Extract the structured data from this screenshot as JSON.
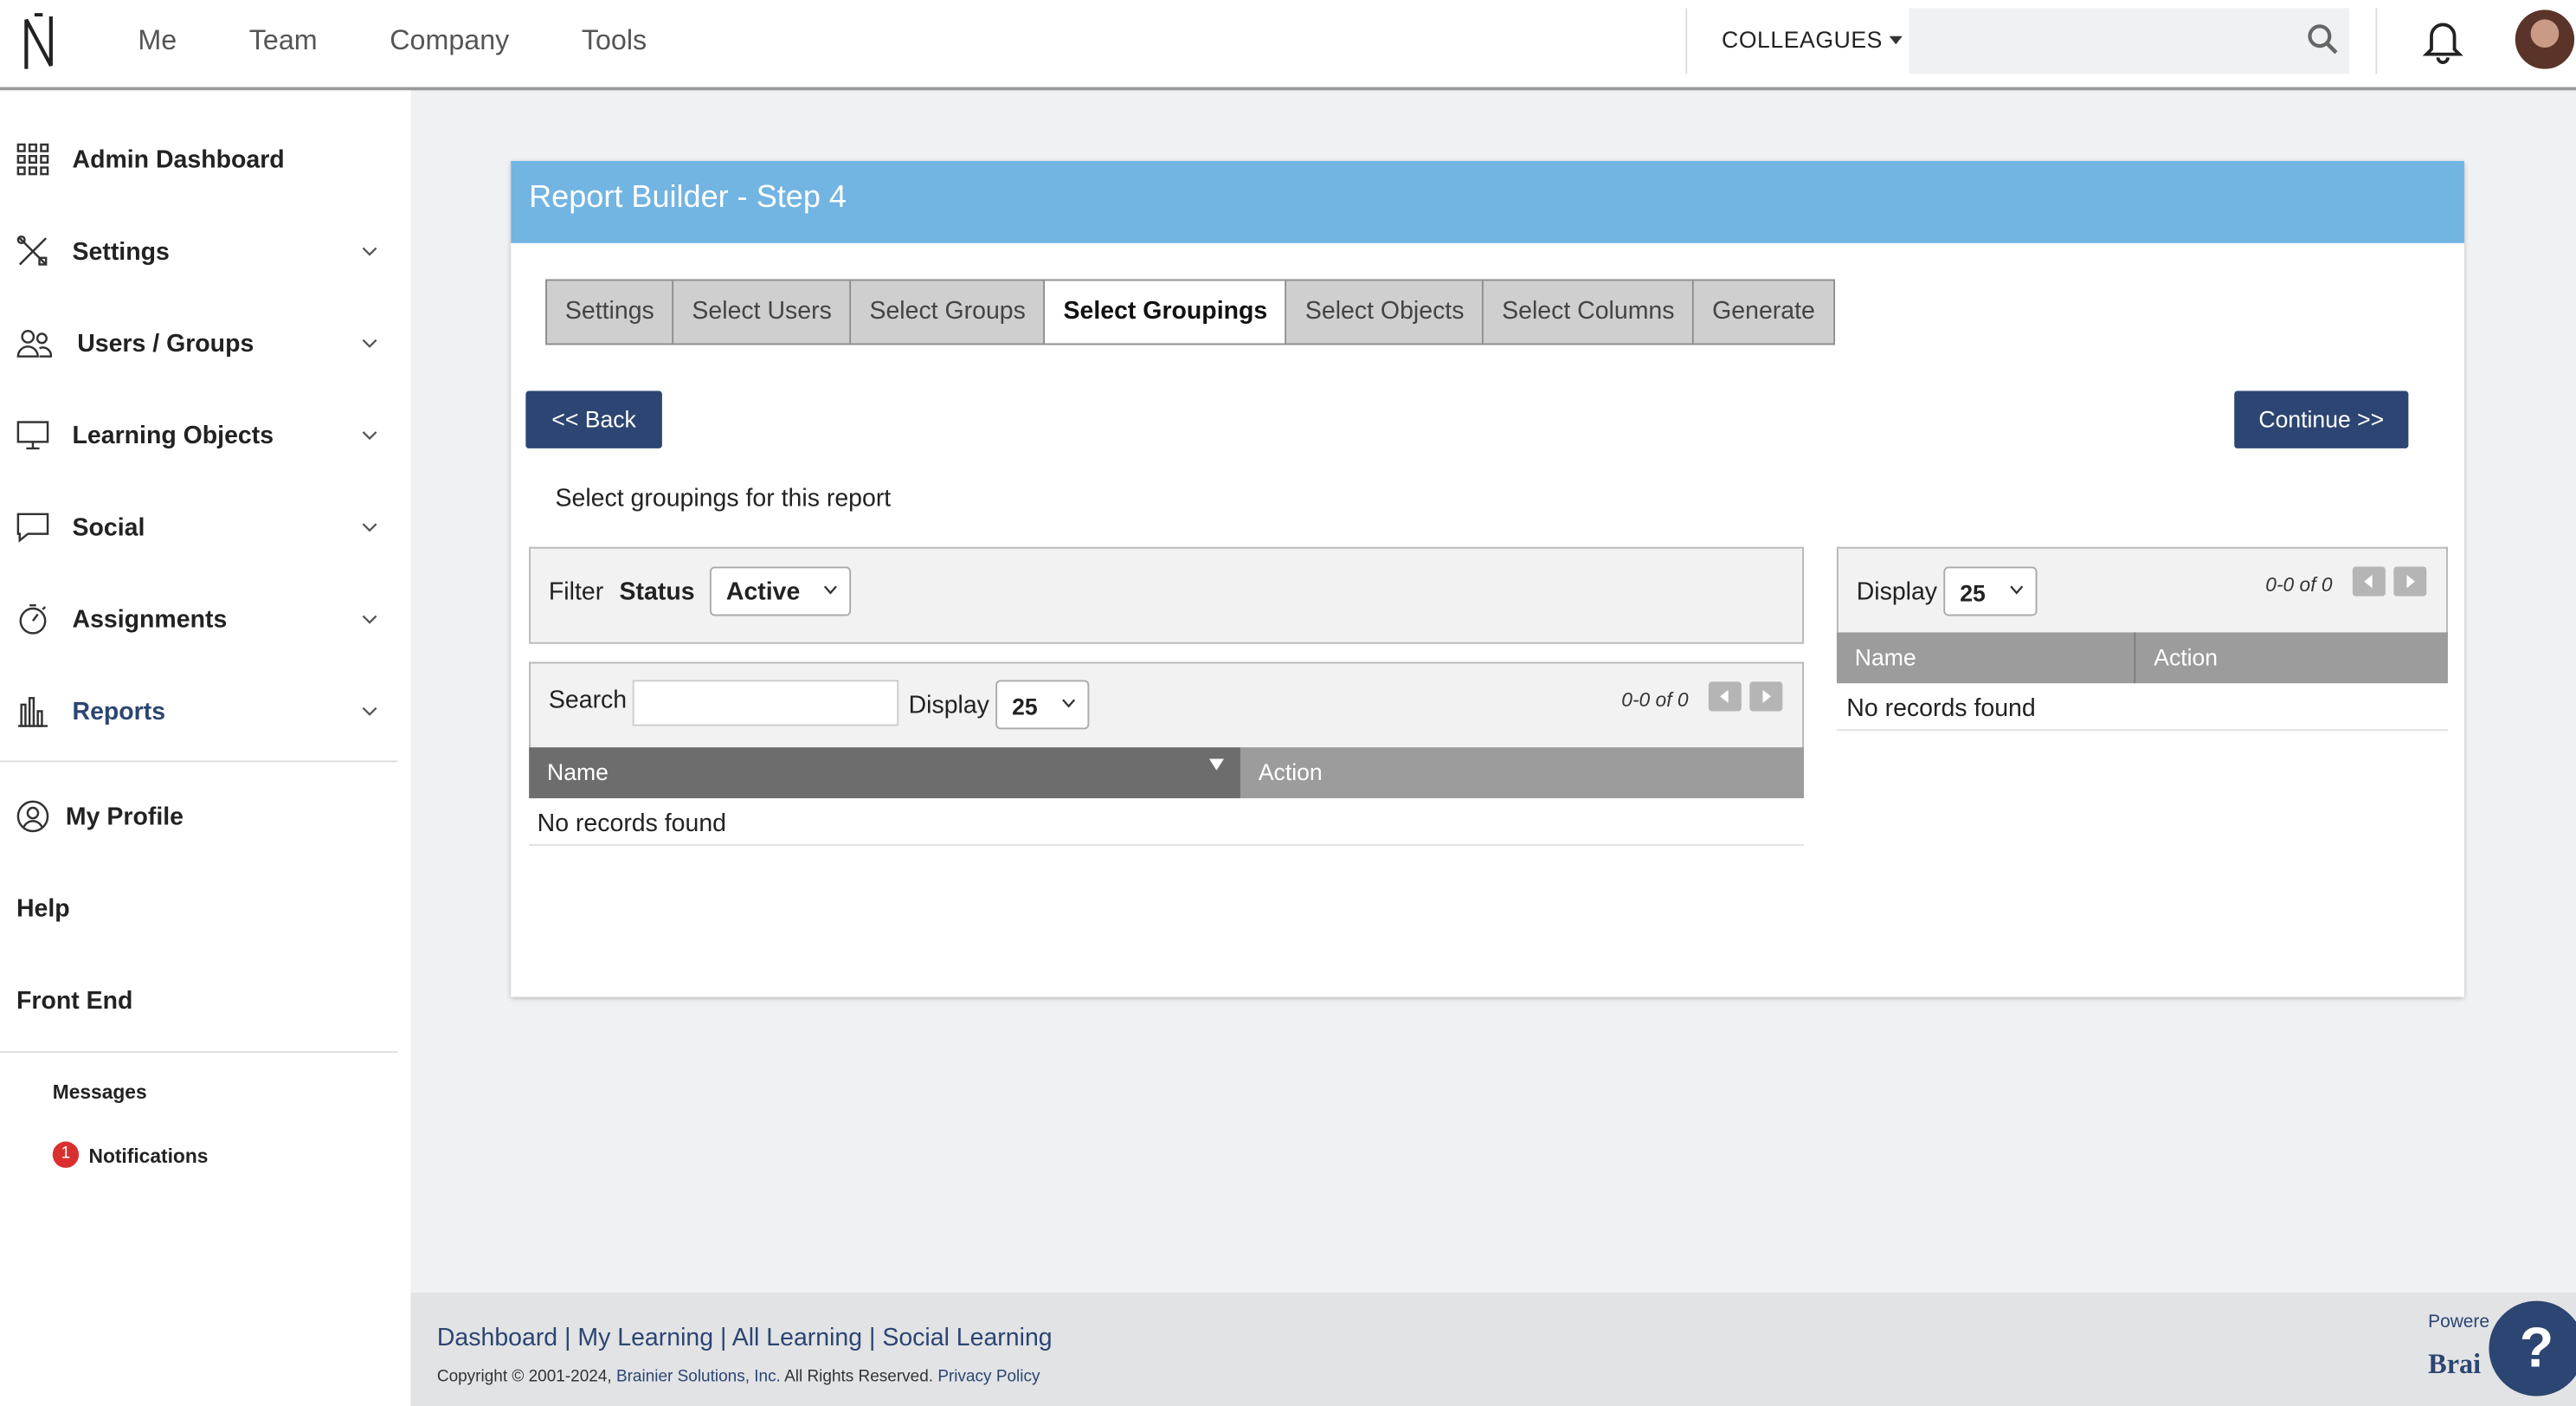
{
  "topbar": {
    "nav": [
      "Me",
      "Team",
      "Company",
      "Tools"
    ],
    "colleagues_label": "COLLEAGUES",
    "search_placeholder": ""
  },
  "sidebar": {
    "items": [
      {
        "label": "Admin Dashboard",
        "icon": "grid-icon",
        "has_chevron": false
      },
      {
        "label": "Settings",
        "icon": "tools-icon",
        "has_chevron": true
      },
      {
        "label": "Users / Groups",
        "icon": "users-icon",
        "has_chevron": true
      },
      {
        "label": "Learning Objects",
        "icon": "monitor-icon",
        "has_chevron": true
      },
      {
        "label": "Social",
        "icon": "chat-icon",
        "has_chevron": true
      },
      {
        "label": "Assignments",
        "icon": "stopwatch-icon",
        "has_chevron": true
      },
      {
        "label": "Reports",
        "icon": "bar-chart-icon",
        "has_chevron": true,
        "active": true
      }
    ],
    "my_profile": "My Profile",
    "help": "Help",
    "front_end": "Front End",
    "messages": "Messages",
    "notifications": "Notifications",
    "notifications_count": "1"
  },
  "card": {
    "title": "Report Builder - Step 4",
    "steps": [
      "Settings",
      "Select Users",
      "Select Groups",
      "Select Groupings",
      "Select Objects",
      "Select Columns",
      "Generate"
    ],
    "active_step": "Select Groupings",
    "back_label": "<< Back",
    "continue_label": "Continue >>",
    "instruction": "Select groupings for this report",
    "filter": {
      "label": "Filter",
      "status_label": "Status",
      "status_value": "Active"
    },
    "left_grid": {
      "search_label": "Search",
      "search_value": "",
      "display_label": "Display",
      "display_value": "25",
      "page_info": "0-0 of 0",
      "columns": [
        "Name",
        "Action"
      ],
      "empty_text": "No records found"
    },
    "right_grid": {
      "display_label": "Display",
      "display_value": "25",
      "page_info": "0-0 of 0",
      "columns": [
        "Name",
        "Action"
      ],
      "empty_text": "No records found"
    }
  },
  "footer": {
    "links": [
      "Dashboard",
      "My Learning",
      "All Learning",
      "Social Learning"
    ],
    "copyright": "Copyright © 2001-2024,",
    "company": "Brainier Solutions, Inc.",
    "rights": "All Rights Reserved.",
    "privacy": "Privacy Policy",
    "powered": "Powere",
    "brand": "Brai"
  },
  "colors": {
    "header_blue": "#72b4e2",
    "navy": "#2c4572",
    "badge_red": "#d9302f"
  }
}
